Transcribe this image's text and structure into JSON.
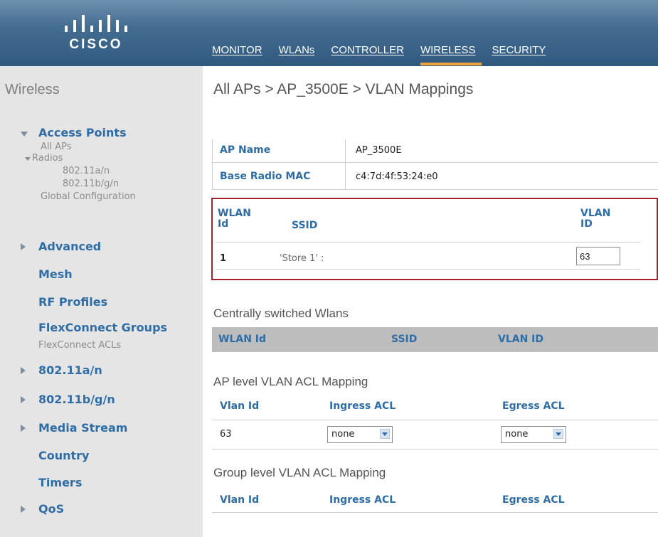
{
  "header": {
    "logo_text": "CISCO",
    "nav": [
      {
        "label": "MONITOR",
        "active": false
      },
      {
        "label": "WLANs",
        "active": false
      },
      {
        "label": "CONTROLLER",
        "active": false
      },
      {
        "label": "WIRELESS",
        "active": true
      },
      {
        "label": "SECURITY",
        "active": false
      }
    ],
    "active_color": "#f0a33a"
  },
  "sidebar": {
    "title": "Wireless",
    "access_points": "Access Points",
    "all_aps": "All APs",
    "radios": "Radios",
    "radio_a": "802.11a/n",
    "radio_b": "802.11b/g/n",
    "global_config": "Global Configuration",
    "advanced": "Advanced",
    "mesh": "Mesh",
    "rf_profiles": "RF Profiles",
    "flex_groups": "FlexConnect Groups",
    "flex_acls": "FlexConnect ACLs",
    "band_a": "802.11a/n",
    "band_b": "802.11b/g/n",
    "media_stream": "Media Stream",
    "country": "Country",
    "timers": "Timers",
    "qos": "QoS"
  },
  "main": {
    "title": "All APs > AP_3500E > VLAN Mappings",
    "ap_name_label": "AP Name",
    "ap_name_value": "AP_3500E",
    "base_mac_label": "Base Radio MAC",
    "base_mac_value": "c4:7d:4f:53:24:e0",
    "mapping_table": {
      "col_wlan_id_1": "WLAN",
      "col_wlan_id_2": "Id",
      "col_ssid": "SSID",
      "col_vlan_id_1": "VLAN",
      "col_vlan_id_2": "ID",
      "row": {
        "wlan_id": "1",
        "ssid": "'Store 1' :",
        "vlan_id": "63"
      }
    },
    "central": {
      "title": "Centrally switched Wlans",
      "col_wlan_id": "WLAN Id",
      "col_ssid": "SSID",
      "col_vlan_id": "VLAN ID"
    },
    "ap_acl": {
      "title": "AP level VLAN ACL Mapping",
      "col_vlan_id": "Vlan Id",
      "col_ingress": "Ingress ACL",
      "col_egress": "Egress ACL",
      "row": {
        "vlan_id": "63",
        "ingress": "none",
        "egress": "none"
      }
    },
    "group_acl": {
      "title": "Group level VLAN ACL Mapping",
      "col_vlan_id": "Vlan Id",
      "col_ingress": "Ingress ACL",
      "col_egress": "Egress ACL"
    },
    "highlight_color": "#a8202a"
  }
}
